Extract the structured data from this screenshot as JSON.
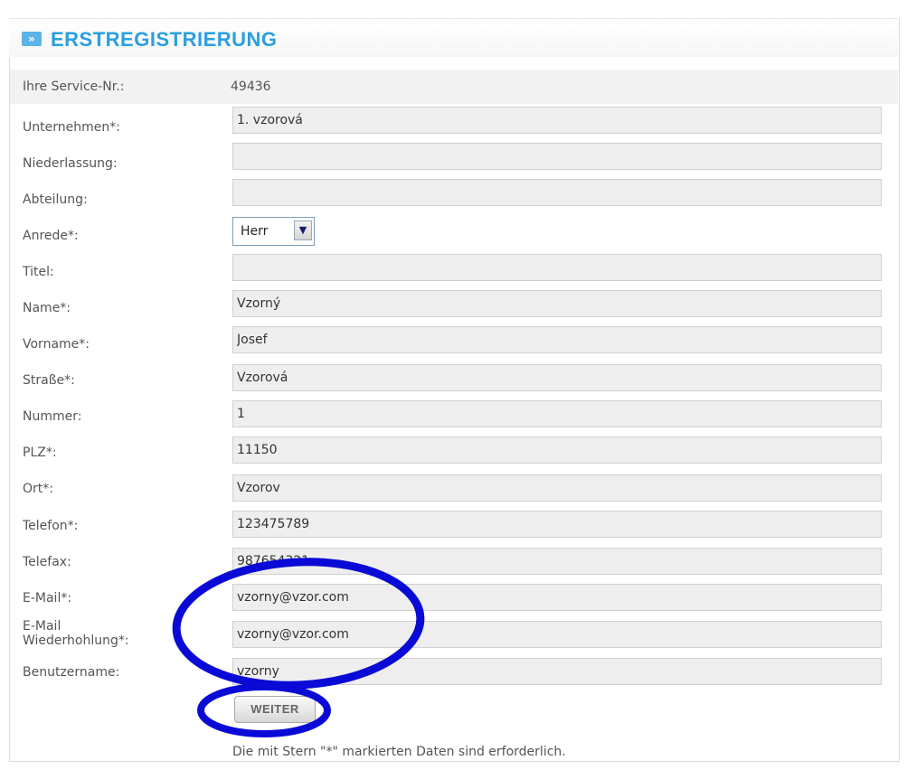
{
  "header": {
    "title": "ERSTREGISTRIERUNG",
    "icon": "double-arrow-right-icon",
    "accent": "#2a9fe0"
  },
  "service": {
    "label": "Ihre Service-Nr.:",
    "value": "49436"
  },
  "fields": {
    "unternehmen": {
      "label": "Unternehmen*:",
      "value": "1. vzorová"
    },
    "niederlassung": {
      "label": "Niederlassung:",
      "value": ""
    },
    "abteilung": {
      "label": "Abteilung:",
      "value": ""
    },
    "anrede": {
      "label": "Anrede*:",
      "value": "Herr"
    },
    "titel": {
      "label": "Titel:",
      "value": ""
    },
    "name": {
      "label": "Name*:",
      "value": "Vzorný"
    },
    "vorname": {
      "label": "Vorname*:",
      "value": "Josef"
    },
    "strasse": {
      "label": "Straße*:",
      "value": "Vzorová"
    },
    "nummer": {
      "label": "Nummer:",
      "value": "1"
    },
    "plz": {
      "label": "PLZ*:",
      "value": "11150"
    },
    "ort": {
      "label": "Ort*:",
      "value": "Vzorov"
    },
    "telefon": {
      "label": "Telefon*:",
      "value": "123475789"
    },
    "telefax": {
      "label": "Telefax:",
      "value": "987654321"
    },
    "email": {
      "label": "E-Mail*:",
      "value": "vzorny@vzor.com"
    },
    "email_repeat": {
      "label": "E-Mail\nWiederhohlung*:",
      "value": "vzorny@vzor.com"
    },
    "benutzername": {
      "label": "Benutzername:",
      "value": "vzorny"
    }
  },
  "buttons": {
    "weiter": "WEITER"
  },
  "note": "Die mit Stern \"*\" markierten Daten sind erforderlich.",
  "annotation_color": "#0a0ad6"
}
